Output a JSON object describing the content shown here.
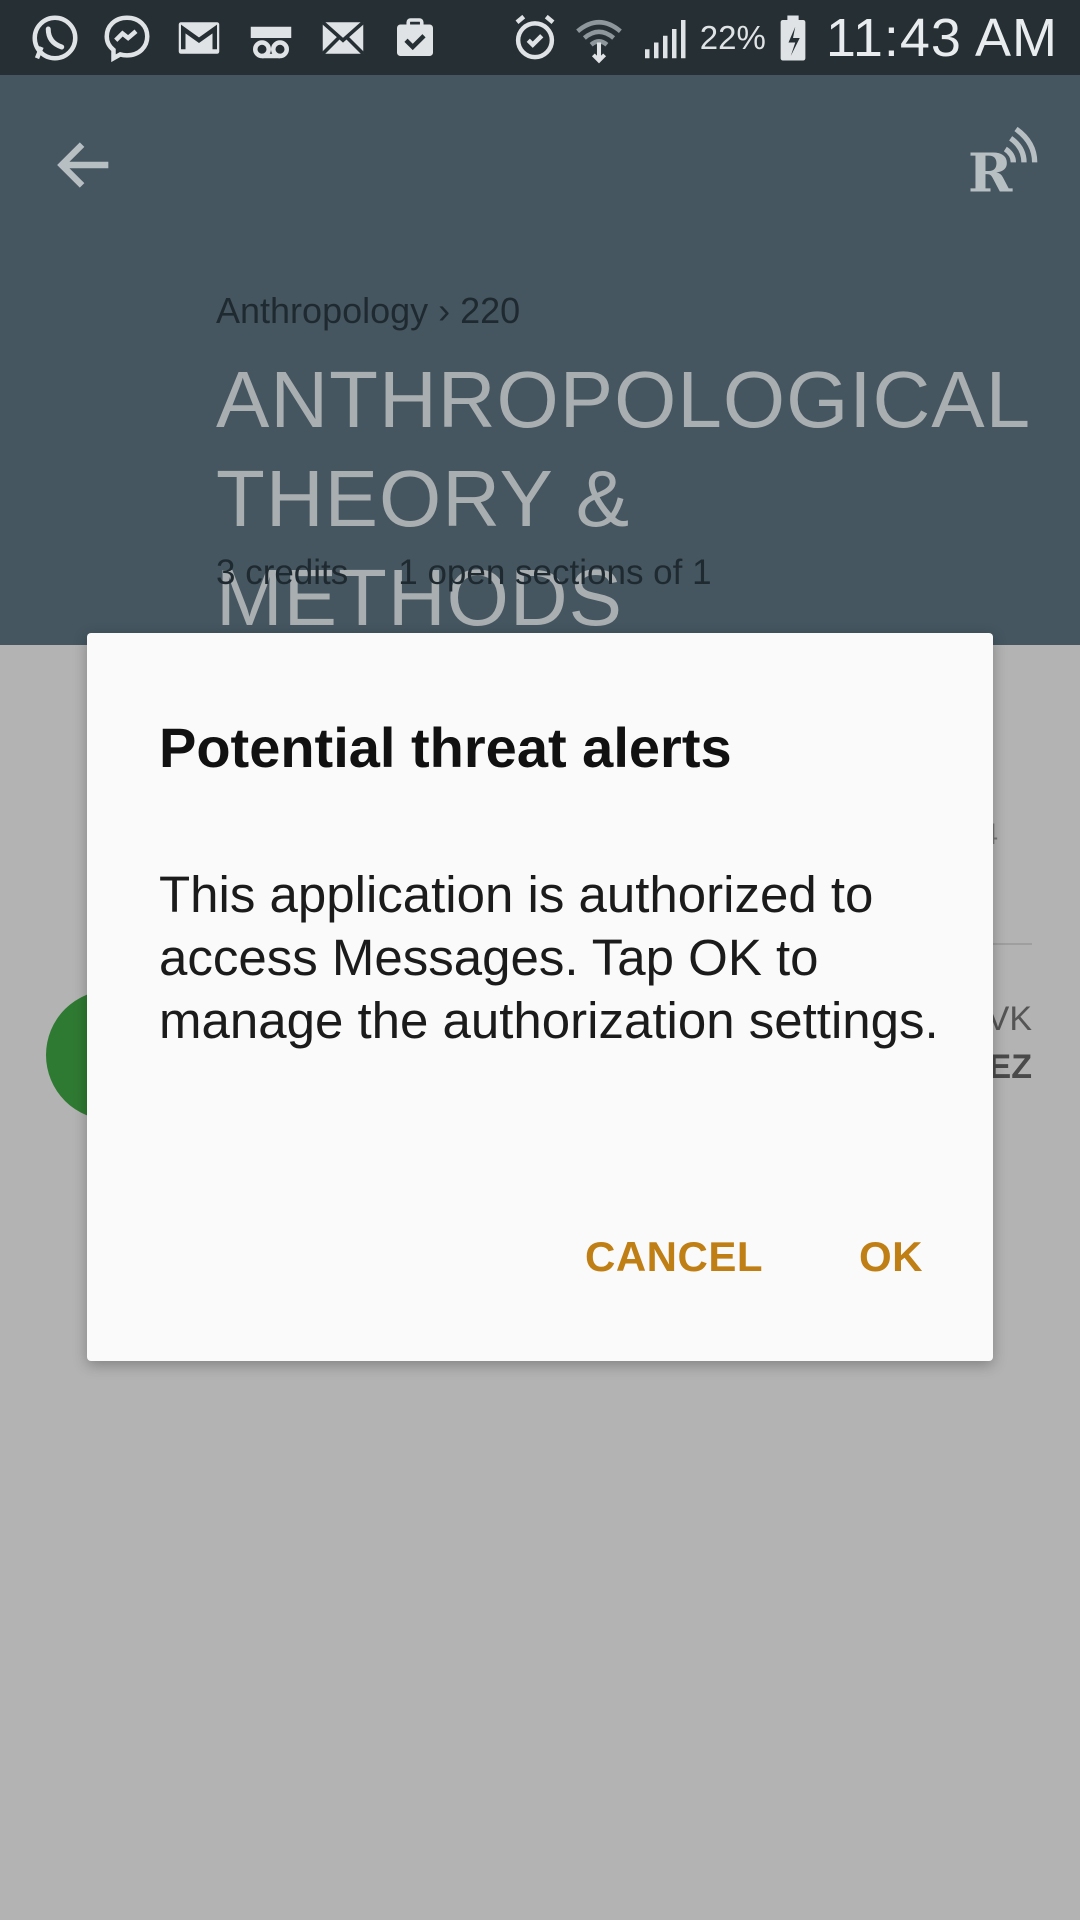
{
  "status_bar": {
    "battery_percent": "22%",
    "time": "11:43 AM",
    "notification_icons": [
      "whatsapp-icon",
      "messenger-icon",
      "gmail-icon",
      "voicemail-icon",
      "email-icon",
      "clipboard-check-icon"
    ],
    "system_icons": [
      "alarm-icon",
      "wifi-icon",
      "signal-icon",
      "battery-charging-icon"
    ]
  },
  "header": {
    "breadcrumb": "Anthropology › 220",
    "title_line1": "ANTHROPOLOGICAL",
    "title_line2": "THEORY & METHODS",
    "credits": "3 credits",
    "sections": "1 open sections of 1",
    "background_color": "#455660"
  },
  "background": {
    "text_0": "4",
    "text_1": "VK",
    "text_2": "EZ"
  },
  "dialog": {
    "title": "Potential threat alerts",
    "message": "This application is authorized to access Messages. Tap OK to manage the authorization settings.",
    "cancel_label": "CANCEL",
    "ok_label": "OK",
    "accent_color": "#c07f14"
  }
}
